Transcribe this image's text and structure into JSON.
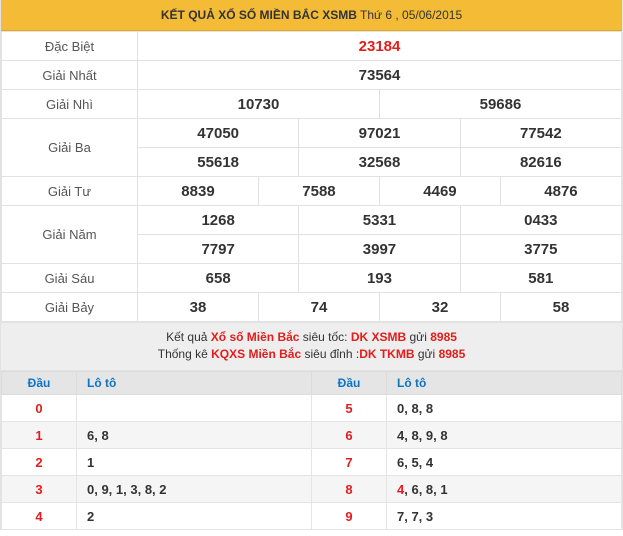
{
  "header": {
    "title_bold": "KẾT QUẢ XỔ SỐ MIỀN BẮC XSMB",
    "title_rest": " Thứ 6 , 05/06/2015"
  },
  "prizes": {
    "dac_biet": {
      "label": "Đặc Biệt",
      "values": [
        "23184"
      ]
    },
    "nhat": {
      "label": "Giải Nhất",
      "values": [
        "73564"
      ]
    },
    "nhi": {
      "label": "Giải Nhì",
      "values": [
        "10730",
        "59686"
      ]
    },
    "ba": {
      "label": "Giải Ba",
      "values": [
        "47050",
        "97021",
        "77542",
        "55618",
        "32568",
        "82616"
      ]
    },
    "tu": {
      "label": "Giải Tư",
      "values": [
        "8839",
        "7588",
        "4469",
        "4876"
      ]
    },
    "nam": {
      "label": "Giải Năm",
      "values": [
        "1268",
        "5331",
        "0433",
        "7797",
        "3997",
        "3775"
      ]
    },
    "sau": {
      "label": "Giải Sáu",
      "values": [
        "658",
        "193",
        "581"
      ]
    },
    "bay": {
      "label": "Giải Bảy",
      "values": [
        "38",
        "74",
        "32",
        "58"
      ]
    }
  },
  "promo": {
    "line1": {
      "a": "Kết quả ",
      "b": "Xổ số Miền Bắc",
      "c": " siêu tốc: ",
      "d": "DK XSMB",
      "e": " gửi ",
      "f": "8985"
    },
    "line2": {
      "a": "Thống kê ",
      "b": "KQXS Miền Bắc",
      "c": " siêu đỉnh :",
      "d": "DK TKMB",
      "e": " gửi ",
      "f": "8985"
    }
  },
  "loto": {
    "headers": {
      "dau": "Đầu",
      "loto": "Lô tô"
    },
    "rows": [
      {
        "left_dau": "0",
        "left_val": "",
        "right_dau": "5",
        "right_val": "0, 8, 8"
      },
      {
        "left_dau": "1",
        "left_val": "6, 8",
        "right_dau": "6",
        "right_val": "4, 8, 9, 8"
      },
      {
        "left_dau": "2",
        "left_val": "1",
        "right_dau": "7",
        "right_val": "6, 5, 4"
      },
      {
        "left_dau": "3",
        "left_val": "0, 9, 1, 3, 8, 2",
        "right_dau": "8",
        "right_val_red": "4",
        "right_val": ", 6, 8, 1"
      },
      {
        "left_dau": "4",
        "left_val": "2",
        "right_dau": "9",
        "right_val": "7, 7, 3"
      }
    ]
  },
  "colors": {
    "header_bg": "#f4bb37",
    "special_red": "#e21d1d",
    "loto_head_blue": "#0b74c4"
  }
}
